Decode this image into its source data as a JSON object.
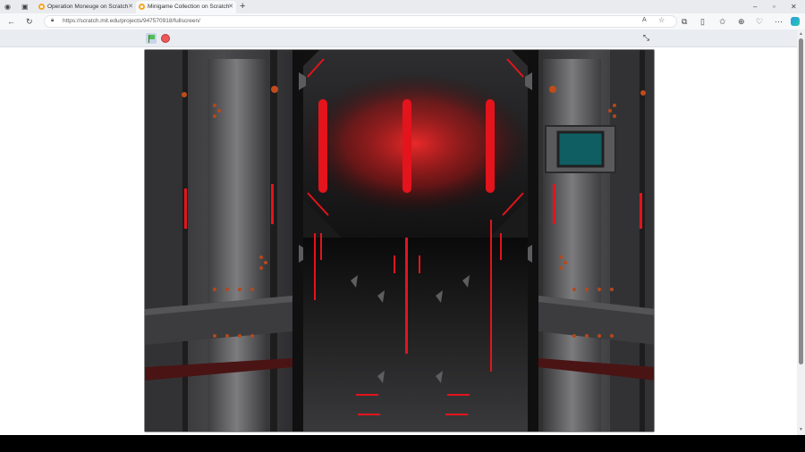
{
  "browser": {
    "tabs": [
      {
        "title": "Operation Moneuge on Scratch",
        "active": false
      },
      {
        "title": "Minigame Collection on Scratch",
        "active": true
      }
    ],
    "url": "https://scratch.mit.edu/projects/947570918/fullscreen/",
    "icons": [
      "profile-icon",
      "tab-actions-icon",
      "new-tab-icon",
      "back-icon",
      "refresh-icon",
      "lock-icon",
      "read-aloud-icon",
      "favorite-icon",
      "extensions-icon",
      "split-screen-icon",
      "favorites-icon",
      "collections-icon",
      "browser-essentials-icon",
      "more-icon",
      "copilot-icon",
      "minimize-icon",
      "maximize-icon",
      "close-icon"
    ]
  },
  "scratch": {
    "green_flag": "green-flag-icon",
    "stop": "stop-icon",
    "fullscreen_toggle": "exit-fullscreen-icon"
  },
  "colors": {
    "accent_red": "#e3141c",
    "panel_gray": "#3c3c3e",
    "green_flag": "#4cbf56",
    "stop_red": "#ec5959"
  }
}
